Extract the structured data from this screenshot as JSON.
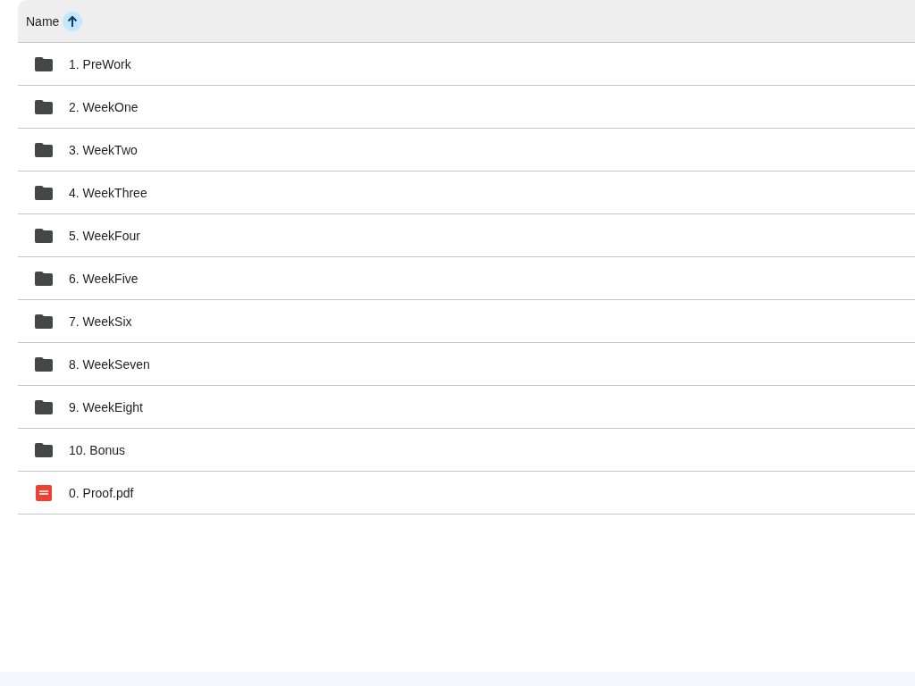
{
  "header": {
    "label": "Name",
    "sort_ascending": true
  },
  "files": [
    {
      "name": "1. PreWork",
      "kind": "folder"
    },
    {
      "name": "2. WeekOne",
      "kind": "folder"
    },
    {
      "name": "3. WeekTwo",
      "kind": "folder"
    },
    {
      "name": "4. WeekThree",
      "kind": "folder"
    },
    {
      "name": "5. WeekFour",
      "kind": "folder"
    },
    {
      "name": "6. WeekFive",
      "kind": "folder"
    },
    {
      "name": "7. WeekSix",
      "kind": "folder"
    },
    {
      "name": "8. WeekSeven",
      "kind": "folder"
    },
    {
      "name": "9. WeekEight",
      "kind": "folder"
    },
    {
      "name": "10. Bonus",
      "kind": "folder"
    },
    {
      "name": "0. Proof.pdf",
      "kind": "pdf"
    }
  ]
}
